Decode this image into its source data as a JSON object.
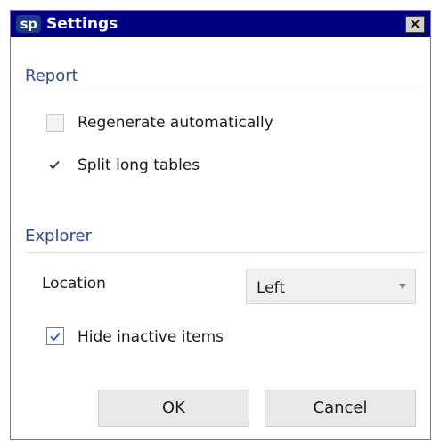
{
  "window": {
    "logo": "sp",
    "title": "Settings",
    "close_glyph": "×",
    "title_bar_color": "#000080"
  },
  "report": {
    "title": "Report",
    "regenerate": {
      "label": "Regenerate automatically",
      "checked": false
    },
    "split_tables": {
      "label": "Split long tables",
      "checked": true
    }
  },
  "explorer": {
    "title": "Explorer",
    "location_label": "Location",
    "location_value": "Left",
    "hide_inactive": {
      "label": "Hide inactive items",
      "checked": true
    }
  },
  "buttons": {
    "ok": "OK",
    "cancel": "Cancel"
  },
  "colors": {
    "section_title": "#2e4b8f",
    "checkmark_dark": "#333333",
    "checkmark_blue": "#2a5aa8"
  }
}
